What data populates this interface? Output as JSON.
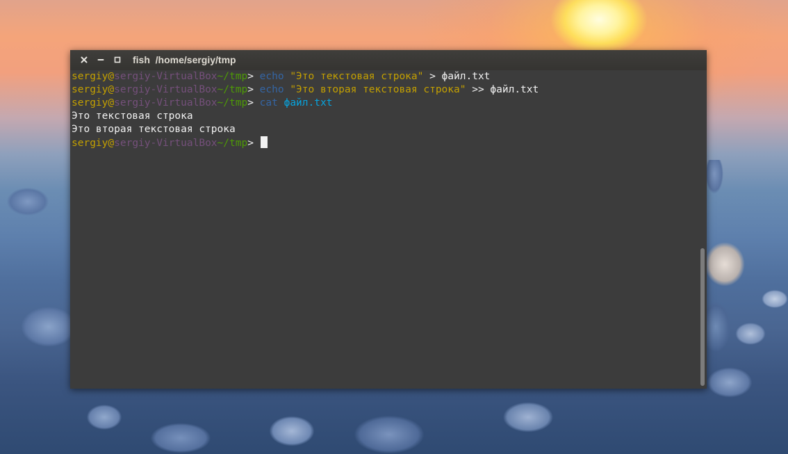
{
  "window": {
    "title": "fish  /home/sergiy/tmp"
  },
  "prompt": {
    "user": "sergiy",
    "at": "@",
    "host": "sergiy-VirtualBox",
    "cwd": "~/tmp",
    "symbol": "> "
  },
  "lines": [
    {
      "type": "command",
      "cmd": "echo",
      "string": "\"Это текстовая строка\"",
      "rest": " > файл.txt"
    },
    {
      "type": "command",
      "cmd": "echo",
      "string": "\"Это вторая текстовая строка\"",
      "rest": " >> файл.txt"
    },
    {
      "type": "command",
      "cmd": "cat",
      "file": "файл.txt"
    },
    {
      "type": "output",
      "text": "Это текстовая строка"
    },
    {
      "type": "output",
      "text": "Это вторая текстовая строка"
    }
  ],
  "scroll": {
    "thumb_start_fraction": 0.56,
    "thumb_size_fraction": 0.44
  },
  "colors": {
    "terminal_bg": "#3c3c3c",
    "prompt_user": "#c4a000",
    "prompt_host": "#75507b",
    "prompt_cwd": "#4e9a06",
    "command": "#3465a4",
    "string": "#c4a000",
    "file_arg": "#06a5e0",
    "text": "#f2f2f2"
  },
  "icons": {
    "close": "close-icon",
    "minimize": "minimize-icon",
    "maximize": "maximize-icon"
  }
}
